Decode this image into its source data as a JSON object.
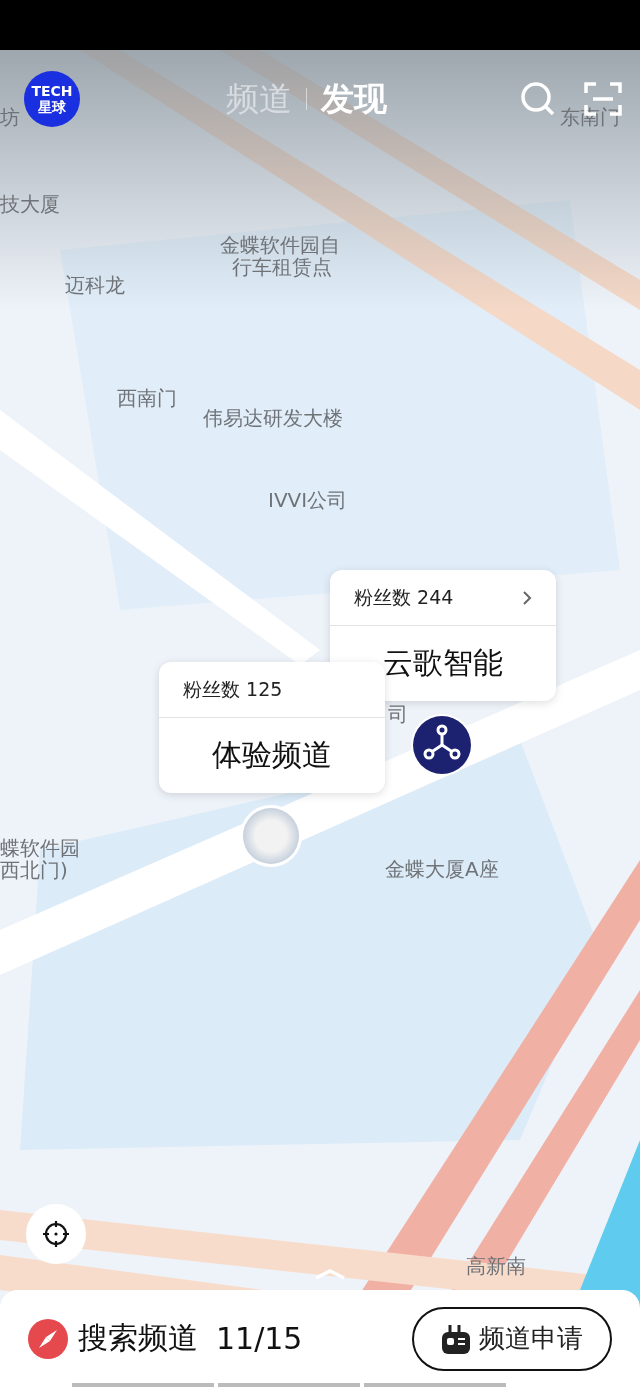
{
  "header": {
    "logo": [
      "TECH",
      "星球"
    ],
    "tabs": [
      {
        "label": "频道",
        "selected": false
      },
      {
        "label": "发现",
        "selected": true
      }
    ]
  },
  "map_labels": [
    {
      "text": "坊"
    },
    {
      "text": "东南门"
    },
    {
      "text": "技大厦"
    },
    {
      "text": "金蝶软件园自"
    },
    {
      "text": "行车租赁点"
    },
    {
      "text": "迈科龙"
    },
    {
      "text": "西南门"
    },
    {
      "text": "伟易达研发大楼"
    },
    {
      "text": "IVVI公司"
    },
    {
      "text": "司"
    },
    {
      "text": "蝶软件园"
    },
    {
      "text": "西北门)"
    },
    {
      "text": "金蝶大厦A座"
    },
    {
      "text": "高新南"
    }
  ],
  "channels": [
    {
      "fans": "粉丝数 244",
      "name": "云歌智能",
      "kind": "logo",
      "has_arrow": true
    },
    {
      "fans": "粉丝数 125",
      "name": "体验频道",
      "kind": "photo",
      "has_arrow": false
    }
  ],
  "bottom_bar": {
    "search_label": "搜索频道",
    "count": "11/15",
    "apply_button": "频道申请"
  }
}
